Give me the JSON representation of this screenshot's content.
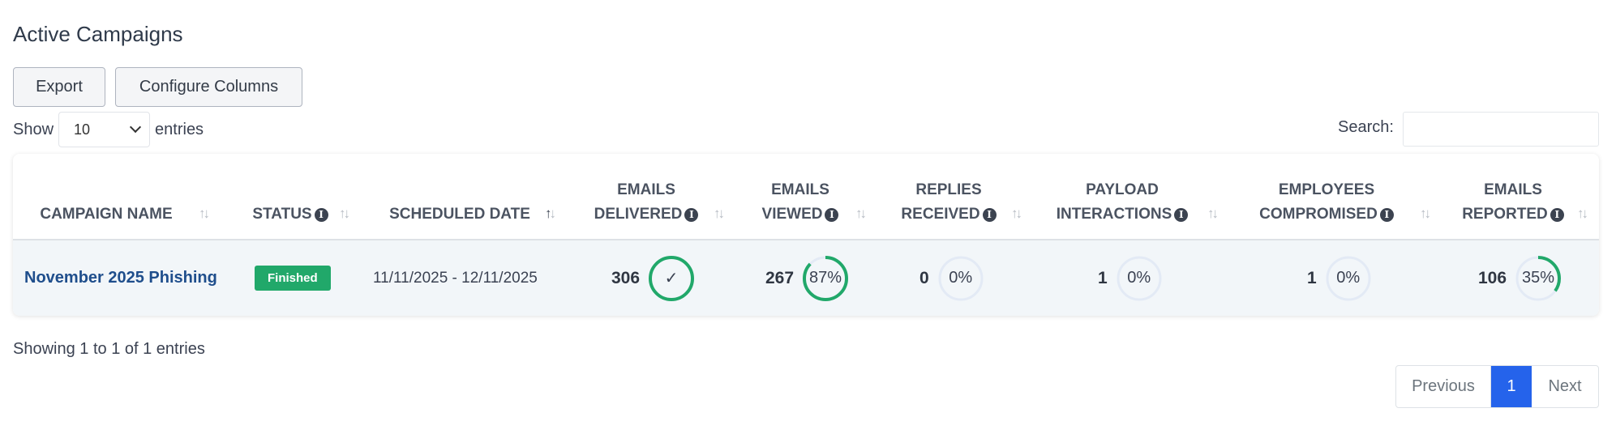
{
  "page": {
    "title": "Active Campaigns"
  },
  "toolbar": {
    "export_label": "Export",
    "configure_label": "Configure Columns"
  },
  "length": {
    "show_label": "Show",
    "value": "10",
    "entries_label": "entries"
  },
  "search": {
    "label": "Search:",
    "value": ""
  },
  "colors": {
    "accent": "#2563eb",
    "success": "#21a86a",
    "link": "#1f4e8c",
    "ring_track": "#e3eaf5"
  },
  "columns": [
    {
      "line1": "",
      "line2": "CAMPAIGN NAME",
      "info": false
    },
    {
      "line1": "",
      "line2": "STATUS",
      "info": true
    },
    {
      "line1": "",
      "line2": "SCHEDULED DATE",
      "info": false,
      "sorted": "asc"
    },
    {
      "line1": "EMAILS",
      "line2": "DELIVERED",
      "info": true
    },
    {
      "line1": "EMAILS",
      "line2": "VIEWED",
      "info": true
    },
    {
      "line1": "REPLIES",
      "line2": "RECEIVED",
      "info": true
    },
    {
      "line1": "PAYLOAD",
      "line2": "INTERACTIONS",
      "info": true
    },
    {
      "line1": "EMPLOYEES",
      "line2": "COMPROMISED",
      "info": true
    },
    {
      "line1": "EMAILS",
      "line2": "REPORTED",
      "info": true
    }
  ],
  "info_glyph": "i",
  "sort_glyph": "↑↓",
  "rows": [
    {
      "campaign_name": "November 2025 Phishing",
      "status": "Finished",
      "scheduled_date": "11/11/2025 - 12/11/2025",
      "metrics": [
        {
          "count": "306",
          "label": "✓",
          "percent": 100
        },
        {
          "count": "267",
          "label": "87%",
          "percent": 87
        },
        {
          "count": "0",
          "label": "0%",
          "percent": 0
        },
        {
          "count": "1",
          "label": "0%",
          "percent": 0
        },
        {
          "count": "1",
          "label": "0%",
          "percent": 0
        },
        {
          "count": "106",
          "label": "35%",
          "percent": 35
        }
      ]
    }
  ],
  "footer": {
    "info": "Showing 1 to 1 of 1 entries"
  },
  "pagination": {
    "previous": "Previous",
    "current": "1",
    "next": "Next"
  }
}
